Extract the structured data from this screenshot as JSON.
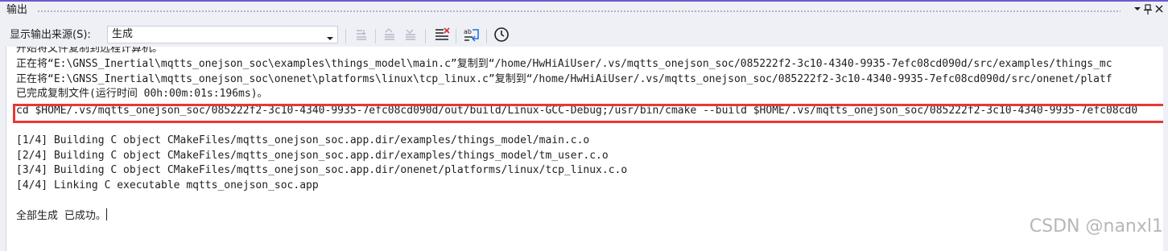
{
  "panel": {
    "title": "输出",
    "dropdown_icon": "chevron-down-icon",
    "pin_icon": "pin-icon",
    "close_icon": "close-icon"
  },
  "toolbar": {
    "source_label": "显示输出来源(S):",
    "source_value": "生成",
    "buttons": [
      {
        "name": "find-message-in-code-icon",
        "enabled": false
      },
      {
        "name": "go-to-previous-message-icon",
        "enabled": false
      },
      {
        "name": "go-to-next-message-icon",
        "enabled": false
      },
      {
        "name": "clear-all-icon",
        "enabled": true
      },
      {
        "name": "toggle-word-wrap-icon",
        "enabled": true
      },
      {
        "name": "show-timestamps-icon",
        "enabled": true
      }
    ]
  },
  "output": {
    "lines": [
      "开始将文件复制到远程计算机。",
      "正在将“E:\\GNSS_Inertial\\mqtts_onejson_soc\\examples\\things_model\\main.c”复制到“/home/HwHiAiUser/.vs/mqtts_onejson_soc/085222f2-3c10-4340-9935-7efc08cd090d/src/examples/things_mc",
      "正在将“E:\\GNSS_Inertial\\mqtts_onejson_soc\\onenet\\platforms\\linux\\tcp_linux.c”复制到“/home/HwHiAiUser/.vs/mqtts_onejson_soc/085222f2-3c10-4340-9935-7efc08cd090d/src/onenet/platf",
      "已完成复制文件(运行时间 00h:00m:01s:196ms)。",
      "cd $HOME/.vs/mqtts_onejson_soc/085222f2-3c10-4340-9935-7efc08cd090d/out/build/Linux-GCC-Debug;/usr/bin/cmake --build $HOME/.vs/mqtts_onejson_soc/085222f2-3c10-4340-9935-7efc08cd0",
      "",
      "[1/4] Building C object CMakeFiles/mqtts_onejson_soc.app.dir/examples/things_model/main.c.o",
      "[2/4] Building C object CMakeFiles/mqtts_onejson_soc.app.dir/examples/things_model/tm_user.c.o",
      "[3/4] Building C object CMakeFiles/mqtts_onejson_soc.app.dir/onenet/platforms/linux/tcp_linux.c.o",
      "[4/4] Linking C executable mqtts_onejson_soc.app",
      "",
      "全部生成 已成功。"
    ]
  },
  "watermark": "CSDN @nanxl1",
  "colors": {
    "accent": "#6a5acd",
    "highlight": "#e53935",
    "background": "#eef0f6",
    "output_bg": "#ffffff"
  }
}
